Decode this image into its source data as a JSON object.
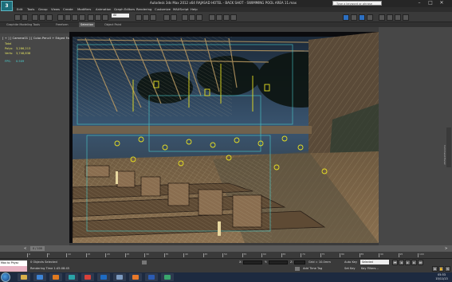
{
  "window": {
    "title": "Autodesk 3ds Max 2012 x64    RAJASAD HOTEL - BACK SHOT - SWIMMING POOL AREA 11.max",
    "search_placeholder": "Type a keyword or phrase",
    "controls": [
      "–",
      "□",
      "✕"
    ]
  },
  "menu": [
    "Edit",
    "Tools",
    "Group",
    "Views",
    "Create",
    "Modifiers",
    "Animation",
    "Graph Editors",
    "Rendering",
    "Customize",
    "MAXScript",
    "Help"
  ],
  "toolbar": {
    "selection_filter": "All",
    "tool_icons": [
      "undo-icon",
      "redo-icon",
      "link-icon",
      "unlink-icon",
      "bind-icon",
      "select-icon",
      "select-by-name-icon",
      "region-icon",
      "window-crossing-icon",
      "move-icon",
      "rotate-icon",
      "scale-icon",
      "snap-icon",
      "angle-snap-icon",
      "mirror-icon",
      "align-icon",
      "layer-icon",
      "curve-editor-icon",
      "schematic-icon",
      "material-editor-icon",
      "render-setup-icon",
      "render-frame-icon",
      "render-icon"
    ]
  },
  "ribbon": {
    "tabs": [
      "Graphite Modeling Tools",
      "Freeform",
      "Selection",
      "Object Paint"
    ],
    "active_tab": "Selection",
    "sub_label": "Polygon Modeling"
  },
  "viewport": {
    "label": "[ + ] [ Camera01 ] [ Color-Pencil + Edged Faces ]",
    "stats": {
      "heading": "Total",
      "polys_label": "Polys:",
      "polys_value": "3,286,213",
      "verts_label": "Verts:",
      "verts_value": "3,748,838",
      "fps_label": "FPS:",
      "fps_value": "0.509"
    }
  },
  "right_panel": {
    "vertical_tab": "Command Panel"
  },
  "timeslider": {
    "frame": "0 / 100",
    "prev": "<",
    "next": ">"
  },
  "trackbar": {
    "ticks": [
      "0",
      "5",
      "10",
      "15",
      "20",
      "25",
      "30",
      "35",
      "40",
      "45",
      "50",
      "55",
      "60",
      "65",
      "70",
      "75",
      "80",
      "85",
      "90",
      "95",
      "100"
    ]
  },
  "status": {
    "maxscript": "Max to Physc",
    "selected": "0 Objects Selected",
    "render_time": "Rendering Time 1:45:08:45",
    "x_label": "X:",
    "y_label": "Y:",
    "z_label": "Z:",
    "grid": "Grid = 10.0mm",
    "auto_time_tag": "Add Time Tag",
    "auto_key": "Auto Key",
    "selected_dropdown": "Selected",
    "set_key": "Set Key",
    "key_filters": "Key Filters..."
  },
  "taskbar": {
    "apps": [
      {
        "name": "folder-app",
        "color": "#d9b04a"
      },
      {
        "name": "ie-app",
        "color": "#3d84d6"
      },
      {
        "name": "media-app",
        "color": "#e07a1f"
      },
      {
        "name": "3dsmax-app",
        "color": "#2aa3a8"
      },
      {
        "name": "chrome-app",
        "color": "#d9413a"
      },
      {
        "name": "photoshop-app",
        "color": "#1e6bc2"
      },
      {
        "name": "explorer-app",
        "color": "#7c9ac0"
      },
      {
        "name": "firefox-app",
        "color": "#e8792a"
      },
      {
        "name": "word-app",
        "color": "#2b5bb3"
      },
      {
        "name": "vray-app",
        "color": "#3aa76d"
      }
    ],
    "time": "05:53",
    "date": "15/11/13"
  },
  "colors": {
    "accent": "#2c6fc1",
    "stats_yellow": "#e0e060",
    "stats_cyan": "#4ad4d4",
    "viewport_sketch": "#c9a96a",
    "selection_highlight": "#e8e022"
  }
}
